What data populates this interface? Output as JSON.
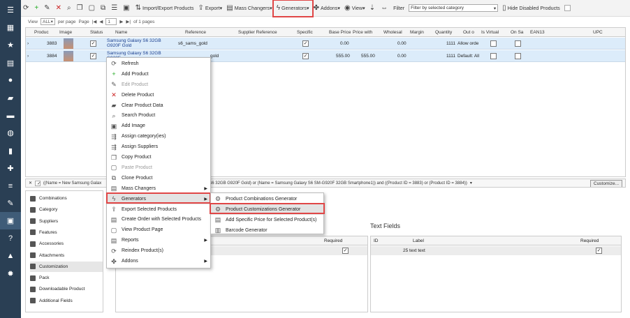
{
  "sidebar": {
    "icons": [
      "menu-icon",
      "store-icon",
      "star-icon",
      "inbox-icon",
      "user-icon",
      "chat-icon",
      "truck-icon",
      "globe-icon",
      "chart-icon",
      "puzzle-icon",
      "sliders-icon",
      "wrench-icon",
      "box-icon",
      "help-icon",
      "lock-icon",
      "gear-icon"
    ]
  },
  "toolbar": {
    "import_export": "Import/Export Products",
    "export": "Export",
    "mass_changers": "Mass Changers",
    "generators": "Generators",
    "addons": "Addons",
    "view": "View",
    "filter_label": "Filter",
    "filter_value": "Filter by selected category",
    "hide_disabled": "Hide Disabled Products"
  },
  "pager": {
    "view_label": "View",
    "view_value": "ALL",
    "per_page": "per page",
    "page_label": "Page",
    "page_value": "1",
    "of_pages": "of 1 pages"
  },
  "grid": {
    "columns": [
      "Produc",
      "Image",
      "Status",
      "Name",
      "Reference",
      "Supplier Reference",
      "Specific",
      "Base Price",
      "Price with",
      "Wholesal",
      "Margin",
      "Quantity",
      "Out o",
      "Is Virtual",
      "On Sa",
      "EAN13",
      "UPC"
    ],
    "rows": [
      {
        "id": "3883",
        "name": "Samsung Galaxy S6 32GB G920F Gold",
        "reference": "s6_sams_gold",
        "base_price": "0.00",
        "price_with": "",
        "wholesale": "0.00",
        "quantity": "1111",
        "out": "Allow orde"
      },
      {
        "id": "3884",
        "name": "Samsung Galaxy S6 32GB G920F",
        "reference": "gold",
        "base_price": "555.00",
        "price_with": "555.00",
        "wholesale": "0.00",
        "quantity": "1111",
        "out": "Default: All"
      }
    ]
  },
  "filterbar": {
    "text_left": "((Name = New Samsung Galax",
    "text_right": "S6 32GB G920F Gold) or (Name = Samsung Galaxy S6 SM-G920F 32GB Smartphone1)) and ((Product ID = 3883) or (Product ID = 3884))",
    "customize": "Customize..."
  },
  "leftnav": [
    "Combinations",
    "Category",
    "Suppliers",
    "Features",
    "Accessories",
    "Attachments",
    "Customization",
    "Pack",
    "Downloadable Product",
    "Additional Fields"
  ],
  "left_panel": {
    "required": "Required"
  },
  "text_fields": {
    "title": "Text Fields",
    "id_col": "ID",
    "label_col": "Label",
    "required_col": "Required",
    "row_label": "25 text text"
  },
  "context_menu": [
    "Refresh",
    "Add Product",
    "Edit Product",
    "Delete Product",
    "Clear Product Data",
    "Search Product",
    "Add Image",
    "Assign category(ies)",
    "Assign Suppliers",
    "Copy Product",
    "Paste Product",
    "Clone Product",
    "Mass Changers",
    "Generators",
    "Export Selected Products",
    "Create Order with Selected Products",
    "View Product Page",
    "Reports",
    "Reindex Product(s)",
    "Addons"
  ],
  "submenu": [
    "Product Combinations Generator",
    "Product Customizations Generator",
    "Add Specific Price for Selected Product(s)",
    "Barcode Generator"
  ]
}
